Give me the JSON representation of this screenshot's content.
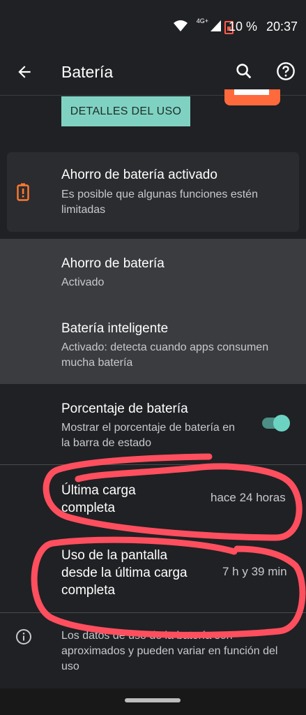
{
  "status_bar": {
    "network": "4G+",
    "battery_percent": "10 %",
    "time": "20:37",
    "icons": [
      "wifi-icon",
      "signal-icon",
      "battery-low-icon"
    ]
  },
  "app_bar": {
    "title": "Batería",
    "icons": [
      "back-arrow-icon",
      "search-icon",
      "help-icon"
    ]
  },
  "usage_details_button": "DETALLES DEL USO",
  "saver_card": {
    "title": "Ahorro de batería activado",
    "subtitle": "Es posible que algunas funciones estén limitadas",
    "icon": "battery-alert-icon"
  },
  "settings": [
    {
      "title": "Ahorro de batería",
      "subtitle": "Activado"
    },
    {
      "title": "Batería inteligente",
      "subtitle": "Activado: detecta cuando apps consumen mucha batería"
    },
    {
      "title": "Porcentaje de batería",
      "subtitle": "Mostrar el porcentaje de batería en la barra de estado",
      "toggle_on": true
    }
  ],
  "stats": [
    {
      "label_line1": "Última carga",
      "label_line2": "completa",
      "value": "hace 24 horas"
    },
    {
      "label_line1": "Uso de la pantalla",
      "label_line2": "desde la última carga",
      "label_line3": "completa",
      "value": "7 h y 39 min"
    }
  ],
  "footer_note": "Los datos de uso de la batería son aproximados y pueden variar en función del uso",
  "colors": {
    "background": "#202124",
    "accent": "#7fd2c2",
    "warning": "#ff7a2f",
    "annotation": "#ff4f5f"
  }
}
